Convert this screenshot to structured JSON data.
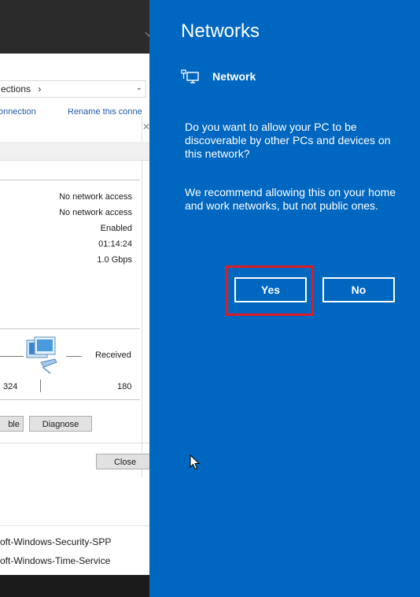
{
  "background_window": {
    "breadcrumb": "ections",
    "breadcrumb_arrow": "›",
    "toolbar": {
      "connection_label": "onnection",
      "rename_label": "Rename this conne"
    },
    "status_values": [
      "No network access",
      "No network access",
      "Enabled",
      "01:14:24",
      "1.0 Gbps"
    ],
    "activity": {
      "received_label": "Received",
      "sent_value": "324",
      "received_value": "180"
    },
    "buttons": {
      "disable_label": "ble",
      "diagnose_label": "Diagnose",
      "close_label": "Close"
    },
    "services": [
      "oft-Windows-Security-SPP",
      "oft-Windows-Time-Service"
    ]
  },
  "flyout": {
    "title": "Networks",
    "network_name": "Network",
    "prompt_text": "Do you want to allow your PC to be discoverable by other PCs and devices on this network?",
    "recommend_text": "We recommend allowing this on your home and work networks, but not public ones.",
    "yes_label": "Yes",
    "no_label": "No"
  },
  "colors": {
    "flyout_background": "#0067c0",
    "highlight_border": "#e01b24"
  },
  "icons": [
    "network-pc-icon",
    "computer-network-icon",
    "mouse-cursor-icon",
    "chevron-down-icon",
    "close-icon"
  ]
}
